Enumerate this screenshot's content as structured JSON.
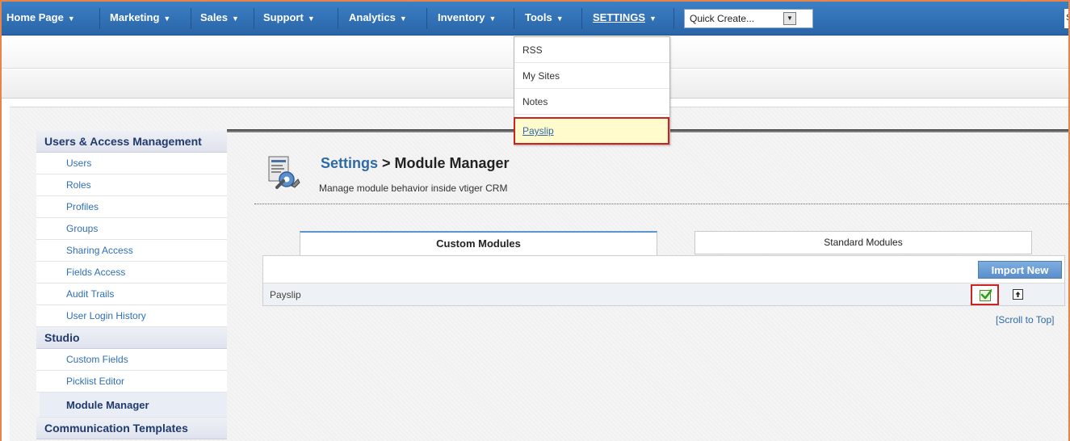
{
  "nav": {
    "tabs": [
      {
        "label": "Home Page"
      },
      {
        "label": "Marketing"
      },
      {
        "label": "Sales"
      },
      {
        "label": "Support"
      },
      {
        "label": "Analytics"
      },
      {
        "label": "Inventory"
      },
      {
        "label": "Tools"
      },
      {
        "label": "SETTINGS"
      }
    ],
    "quick_create": {
      "value": "Quick Create..."
    },
    "right_cut_text": "S"
  },
  "tools_menu": {
    "items": [
      {
        "label": "RSS"
      },
      {
        "label": "My Sites"
      },
      {
        "label": "Notes"
      },
      {
        "label": "Payslip"
      }
    ]
  },
  "sidebar": {
    "sections": [
      {
        "title": "Users & Access Management",
        "items": [
          "Users",
          "Roles",
          "Profiles",
          "Groups",
          "Sharing Access",
          "Fields Access",
          "Audit Trails",
          "User Login History"
        ]
      },
      {
        "title": "Studio",
        "items": [
          "Custom Fields",
          "Picklist Editor",
          "Module Manager"
        ]
      },
      {
        "title": "Communication Templates",
        "items": []
      }
    ],
    "active_item": "Module Manager"
  },
  "main": {
    "breadcrumb_root": "Settings",
    "breadcrumb_sep": " > ",
    "title": "Module Manager",
    "description": "Manage module behavior inside vtiger CRM",
    "tabs": [
      {
        "label": "Custom Modules",
        "selected": true
      },
      {
        "label": "Standard Modules",
        "selected": false
      }
    ],
    "import_button": "Import New",
    "modules": [
      {
        "name": "Payslip",
        "enabled": true
      }
    ],
    "scroll_to_top": "[Scroll to Top]"
  },
  "colors": {
    "nav_bg": "#3070b8",
    "accent_link": "#2e6aa7",
    "highlight_border": "#cc2222",
    "frame_border": "#e8844a"
  },
  "icons": {
    "nav_caret": "chevron-down-icon",
    "module_manager": "module-manager-icon",
    "enable": "checkbox-checked-icon",
    "export": "export-arrow-icon"
  }
}
